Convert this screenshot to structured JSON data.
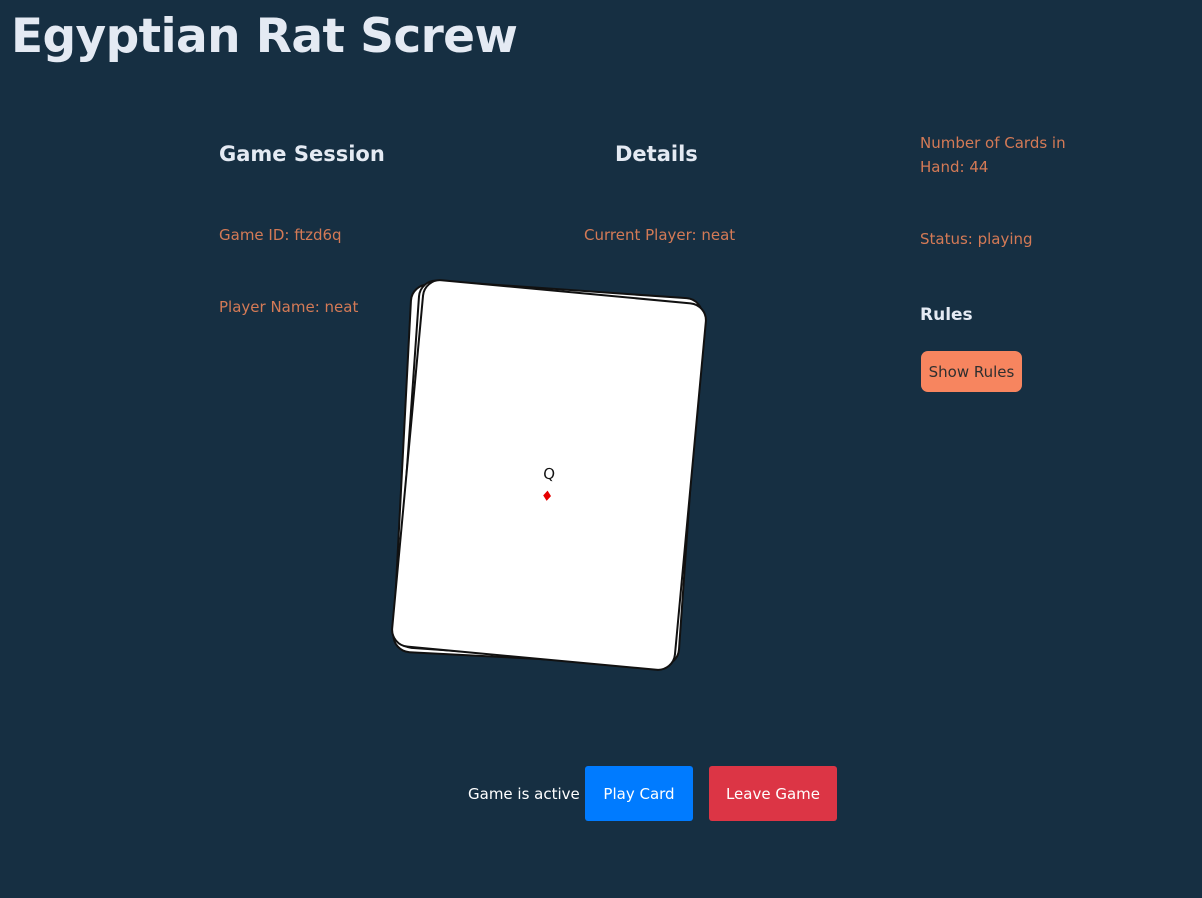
{
  "app": {
    "title": "Egyptian Rat Screw"
  },
  "session": {
    "heading": "Game Session",
    "game_id": "Game ID: ftzd6q",
    "player_name": "Player Name: neat"
  },
  "details": {
    "heading": "Details",
    "current_player": "Current Player: neat"
  },
  "stats": {
    "cards_in_hand": "Number of Cards in Hand: 44",
    "status": "Status: playing"
  },
  "rules": {
    "heading": "Rules",
    "show_label": "Show Rules"
  },
  "pile": {
    "top_card": {
      "rank": "Q",
      "suit": "♦",
      "suit_color": "#e60000"
    }
  },
  "controls": {
    "status_text": "Game is active",
    "play_label": "Play Card",
    "leave_label": "Leave Game",
    "play_color": "#007bff",
    "leave_color": "#dc3545"
  },
  "colors": {
    "background": "#162f42",
    "heading_text": "#e4eaf3",
    "info_text": "#d47a56",
    "rules_button": "#f7855f"
  }
}
